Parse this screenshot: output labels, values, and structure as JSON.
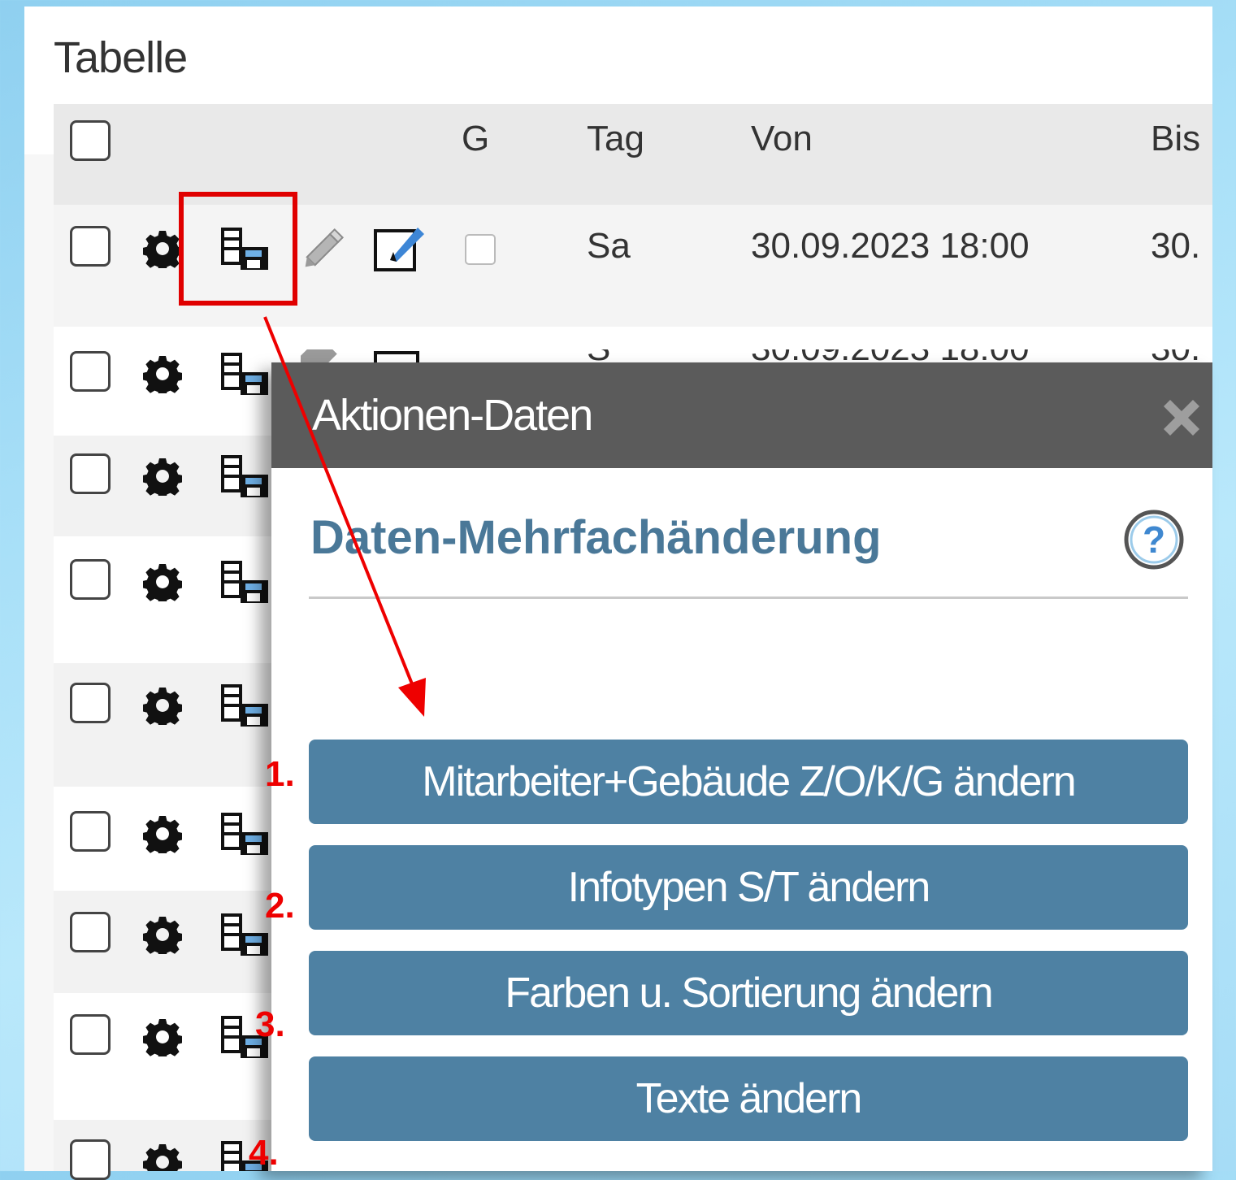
{
  "panel": {
    "title": "Tabelle"
  },
  "table": {
    "headers": {
      "g": "G",
      "tag": "Tag",
      "von": "Von",
      "bis": "Bis"
    },
    "first_row": {
      "tag": "Sa",
      "von": "30.09.2023 18:00",
      "bis": "30. "
    },
    "hidden_row_tag": "S",
    "hidden_row_von": "30.09.2023 18:00",
    "hidden_row_bis": "30."
  },
  "dialog": {
    "title": "Aktionen-Daten",
    "close_icon": "close-icon",
    "section_title": "Daten-Mehrfachänderung",
    "help_icon": "help-icon",
    "buttons": [
      {
        "label": "Mitarbeiter+Gebäude Z/O/K/G ändern"
      },
      {
        "label": "Infotypen S/T ändern"
      },
      {
        "label": "Farben u. Sortierung ändern"
      },
      {
        "label": "Texte ändern"
      }
    ]
  },
  "annotations": {
    "n1": "1.",
    "n2": "2.",
    "n3": "3.",
    "n4": "4."
  },
  "colors": {
    "accent": "#4e81a3",
    "highlight": "#e00000",
    "dialog_header": "#5b5b5b"
  }
}
